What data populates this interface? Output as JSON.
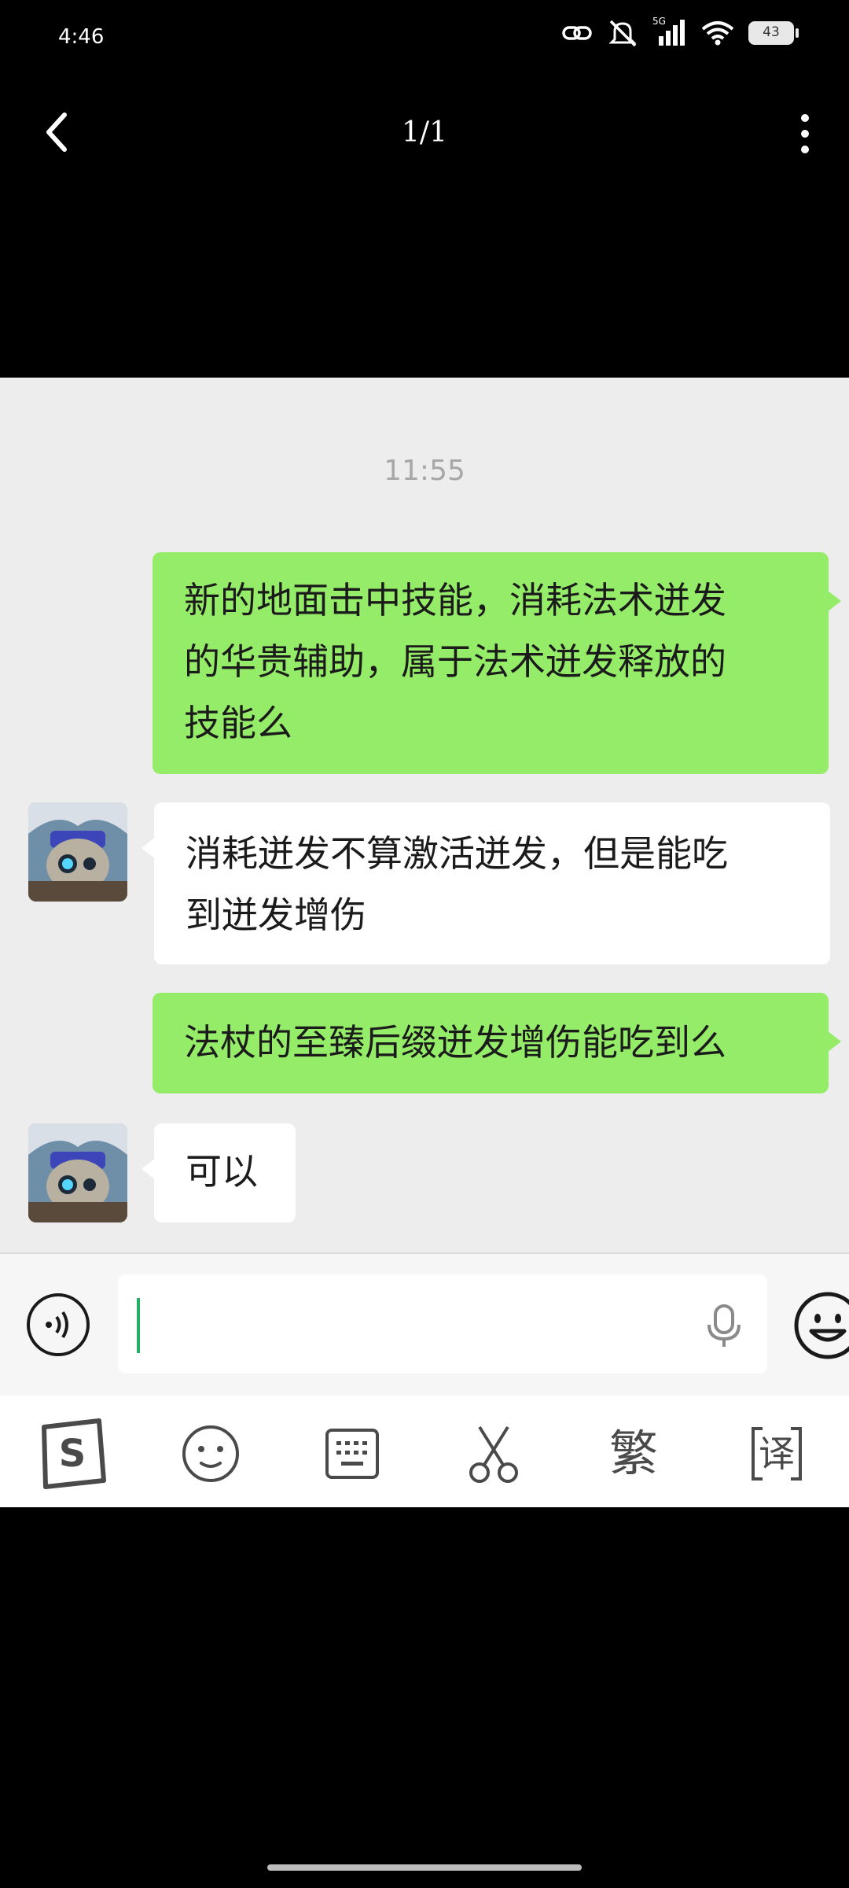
{
  "status_bar": {
    "time": "4:46",
    "network": "5G",
    "battery": "43",
    "icons": [
      "link-icon",
      "mute-icon",
      "signal-icon",
      "wifi-icon",
      "battery-icon"
    ]
  },
  "viewer": {
    "page_counter": "1/1",
    "back_icon": "chevron-left-icon",
    "more_icon": "more-vertical-icon"
  },
  "chat": {
    "timestamp": "11:55",
    "messages": [
      {
        "side": "out",
        "lines": [
          "新的地面击中技能，消耗法术迸发",
          "的华贵辅助，属于法术迸发释放的",
          "技能么"
        ]
      },
      {
        "side": "in",
        "lines": [
          "消耗迸发不算激活迸发，但是能吃",
          "到迸发增伤"
        ]
      },
      {
        "side": "out",
        "lines": [
          "法杖的至臻后缀迸发增伤能吃到么"
        ]
      },
      {
        "side": "in",
        "lines": [
          "可以"
        ]
      }
    ],
    "colors": {
      "outgoing": "#95ec69",
      "incoming": "#ffffff",
      "background": "#ededed"
    }
  },
  "input_bar": {
    "value": "",
    "voice_icon": "voice-mode-icon",
    "mic_icon": "microphone-icon",
    "emoji_icon": "emoji-icon"
  },
  "keyboard_toolbar": {
    "items": [
      {
        "icon": "sogou-logo-icon"
      },
      {
        "icon": "smiley-icon"
      },
      {
        "icon": "keyboard-icon"
      },
      {
        "icon": "scissors-icon"
      },
      {
        "icon": "traditional-chinese-icon",
        "label": "繁"
      },
      {
        "icon": "translate-icon",
        "label": "译"
      }
    ]
  }
}
